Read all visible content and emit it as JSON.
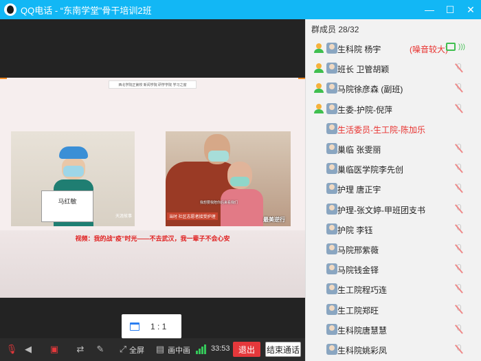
{
  "window": {
    "title": "QQ电话 - “东南学堂”骨干培训2班",
    "buttons": [
      "minimize",
      "maximize",
      "close"
    ]
  },
  "video": {
    "slide_header": "西北学院正第校    新闻学院    研学学院    学习之窗",
    "left_sign": "马红敏",
    "left_watermark": "天涯故事",
    "right_subtitle": "我想要我陪你后来看我们",
    "right_chip": "当时 社区志愿者接受护理",
    "right_brand": "最美逆行",
    "caption": "视频：我的战“疫”时光——不去武汉，我一辈子不会心安"
  },
  "ratio": {
    "label": "1 : 1"
  },
  "toolbar": {
    "fullscreen_label": "全屏",
    "pip_label": "画中画",
    "duration": "33:53",
    "exit_label": "退出",
    "end_label": "结束通话"
  },
  "panel": {
    "title": "群成员 28/32",
    "members": [
      {
        "name": "生科院 杨宇",
        "note": "(噪音较大)",
        "admin": true,
        "red": false
      },
      {
        "name": "班长 卫管胡颖",
        "admin": true,
        "red": false
      },
      {
        "name": "马院徐彦森 (副班)",
        "admin": true,
        "red": false
      },
      {
        "name": "生委-护院-倪萍",
        "admin": true,
        "red": false
      },
      {
        "name": "生活委员-生工院-陈加乐",
        "admin": false,
        "red": true
      },
      {
        "name": "巢临 张雯丽",
        "admin": false,
        "red": false
      },
      {
        "name": "巢临医学院李先创",
        "admin": false,
        "red": false
      },
      {
        "name": "护理 唐正宇",
        "admin": false,
        "red": false
      },
      {
        "name": "护理-张文婷-甲班团支书",
        "admin": false,
        "red": false
      },
      {
        "name": "护院 李钰",
        "admin": false,
        "red": false
      },
      {
        "name": "马院邢紫薇",
        "admin": false,
        "red": false
      },
      {
        "name": "马院钱金铎",
        "admin": false,
        "red": false
      },
      {
        "name": "生工院程巧连",
        "admin": false,
        "red": false
      },
      {
        "name": "生工院郑旺",
        "admin": false,
        "red": false
      },
      {
        "name": "生科院唐慧慧",
        "admin": false,
        "red": false
      },
      {
        "name": "生科院姚彩凤",
        "admin": false,
        "red": false
      }
    ]
  }
}
